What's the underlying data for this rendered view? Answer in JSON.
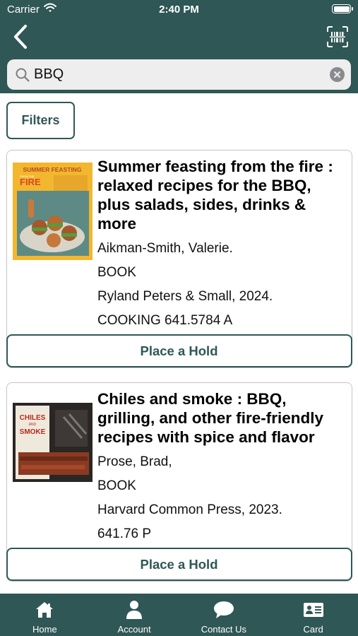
{
  "status_bar": {
    "carrier": "Carrier",
    "time": "2:40 PM"
  },
  "header": {
    "back_icon": "chevron-left-icon",
    "scan_icon": "barcode-scan-icon"
  },
  "search": {
    "value": "BBQ",
    "icon": "search-icon",
    "clear_icon": "clear-icon"
  },
  "filters": {
    "label": "Filters"
  },
  "results": [
    {
      "title": "Summer feasting from the fire : relaxed recipes for the BBQ, plus salads, sides, drinks & more",
      "author": "Aikman-Smith, Valerie.",
      "format": "BOOK",
      "publisher": "Ryland Peters & Small, 2024.",
      "call_number": "COOKING 641.5784 A",
      "cover_text": {
        "top": "SUMMER FEASTING",
        "small": "FROM THE",
        "big": "FIRE"
      },
      "hold_label": "Place a Hold"
    },
    {
      "title": "Chiles and smoke : BBQ, grilling, and other fire-friendly recipes with spice and flavor",
      "author": "Prose, Brad,",
      "format": "BOOK",
      "publisher": "Harvard Common Press, 2023.",
      "call_number": "641.76 P",
      "cover_text": {
        "top": "CHILES",
        "small": "AND",
        "big": "SMOKE"
      },
      "hold_label": "Place a Hold"
    }
  ],
  "tabbar": [
    {
      "label": "Home",
      "icon": "home-icon"
    },
    {
      "label": "Account",
      "icon": "account-icon"
    },
    {
      "label": "Contact Us",
      "icon": "chat-icon"
    },
    {
      "label": "Card",
      "icon": "library-card-icon"
    }
  ],
  "colors": {
    "primary": "#2f5755",
    "search_bg": "#eeeeee",
    "card_border": "#c5c5c5"
  }
}
